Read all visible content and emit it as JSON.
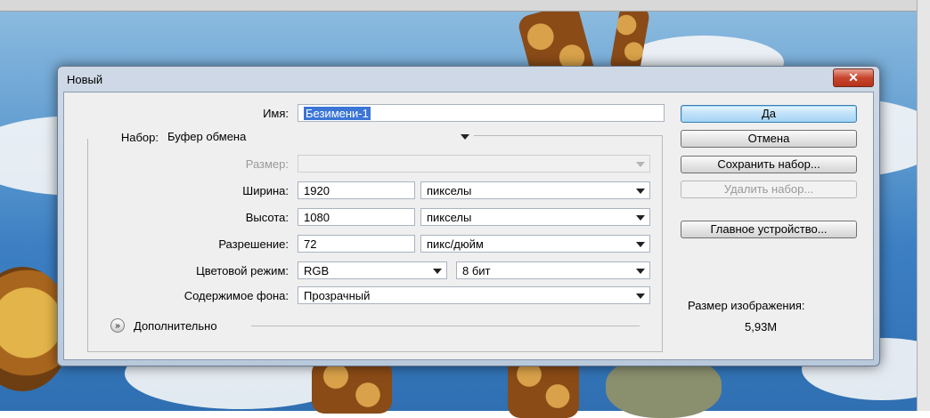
{
  "window": {
    "title": "Новый",
    "close_glyph": "✕"
  },
  "form": {
    "name_label": "Имя:",
    "name_value": "Безимени-1",
    "preset_label": "Набор:",
    "preset_value": "Буфер обмена",
    "size_label": "Размер:",
    "size_value": "",
    "width_label": "Ширина:",
    "width_value": "1920",
    "width_unit": "пикселы",
    "height_label": "Высота:",
    "height_value": "1080",
    "height_unit": "пикселы",
    "resolution_label": "Разрешение:",
    "resolution_value": "72",
    "resolution_unit": "пикс/дюйм",
    "color_mode_label": "Цветовой режим:",
    "color_mode_value": "RGB",
    "bit_depth_value": "8 бит",
    "background_label": "Содержимое фона:",
    "background_value": "Прозрачный",
    "advanced_label": "Дополнительно",
    "advanced_icon": "chevron-double-down-icon",
    "advanced_glyph": "»"
  },
  "buttons": {
    "ok": "Да",
    "cancel": "Отмена",
    "save_preset": "Сохранить набор...",
    "delete_preset": "Удалить набор...",
    "device_central": "Главное устройство..."
  },
  "info": {
    "image_size_label": "Размер изображения:",
    "image_size_value": "5,93M"
  },
  "colors": {
    "selection": "#3b75d6",
    "close_button": "#c7452d",
    "dialog_frame": "#b9c9dc"
  }
}
